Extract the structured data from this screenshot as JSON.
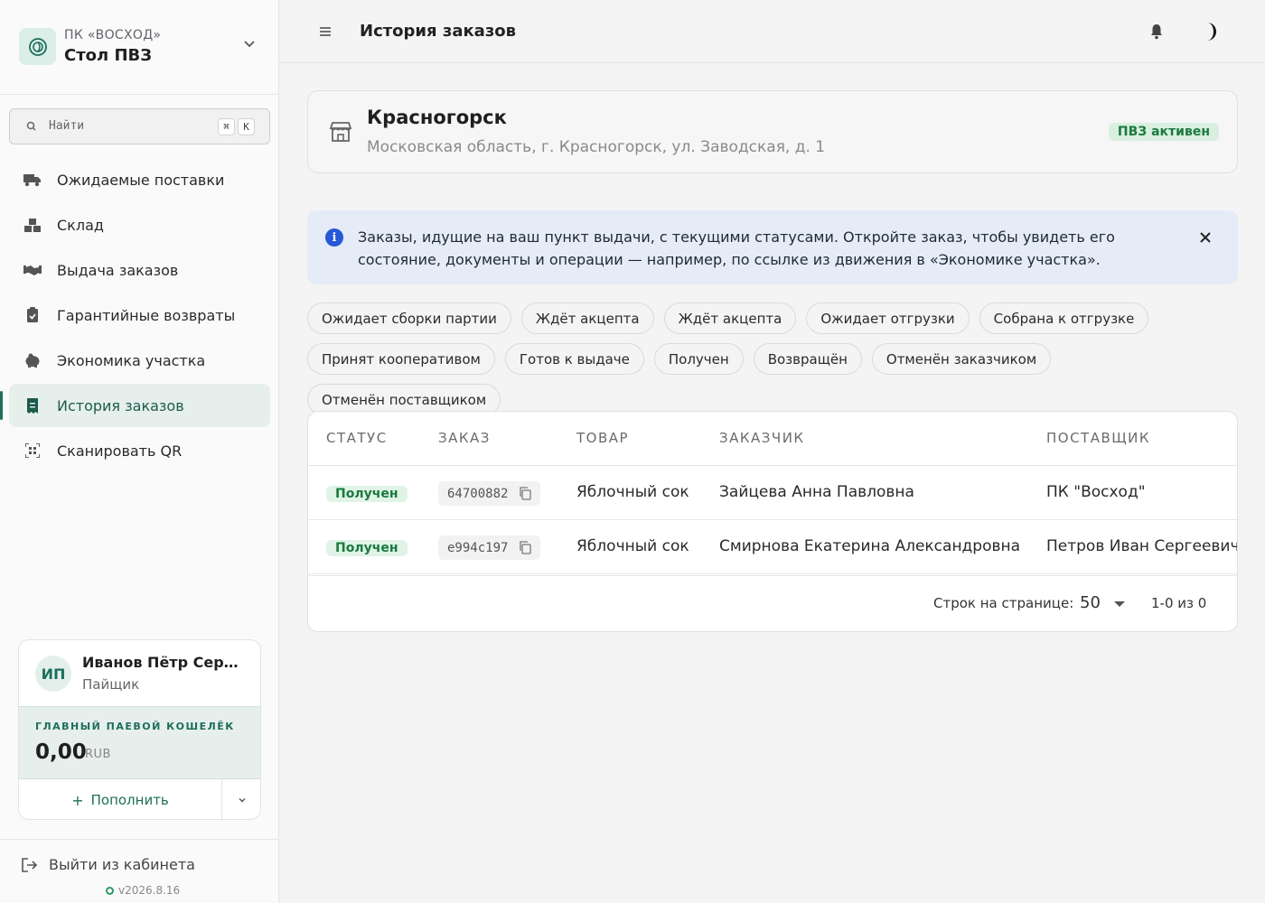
{
  "sidebar": {
    "org_subtitle": "ПК «ВОСХОД»",
    "org_name": "Стол ПВЗ",
    "search_placeholder": "Найти",
    "search_shortcut": [
      "⌘",
      "K"
    ],
    "nav": [
      {
        "label": "Ожидаемые поставки",
        "icon": "truck-icon"
      },
      {
        "label": "Склад",
        "icon": "boxes-icon"
      },
      {
        "label": "Выдача заказов",
        "icon": "handshake-icon"
      },
      {
        "label": "Гарантийные возвраты",
        "icon": "clipboard-check-icon"
      },
      {
        "label": "Экономика участка",
        "icon": "piggy-bank-icon"
      },
      {
        "label": "История заказов",
        "icon": "receipt-icon",
        "active": true
      },
      {
        "label": "Сканировать QR",
        "icon": "qr-scan-icon"
      }
    ],
    "user": {
      "initials": "ИП",
      "name": "Иванов Пётр Сергеевич",
      "role": "Пайщик"
    },
    "wallet": {
      "title": "ГЛАВНЫЙ ПАЕВОЙ КОШЕЛЁК",
      "amount": "0,00",
      "currency": "RUB",
      "topup_label": "Пополнить"
    },
    "logout_label": "Выйти из кабинета",
    "version": "v2026.8.16"
  },
  "header": {
    "title": "История заказов"
  },
  "location": {
    "city": "Красногорск",
    "address": "Московская область, г. Красногорск, ул. Заводская, д. 1",
    "status": "ПВЗ активен"
  },
  "info": {
    "text": "Заказы, идущие на ваш пункт выдачи, с текущими статусами. Откройте заказ, чтобы увидеть его состояние, документы и операции — например, по ссылке из движения в «Экономике участка»."
  },
  "filters": [
    "Ожидает сборки партии",
    "Ждёт акцепта",
    "Ждёт акцепта",
    "Ожидает отгрузки",
    "Собрана к отгрузке",
    "Принят кооперативом",
    "Готов к выдаче",
    "Получен",
    "Возвращён",
    "Отменён заказчиком",
    "Отменён поставщиком"
  ],
  "table": {
    "columns": [
      "СТАТУС",
      "ЗАКАЗ",
      "ТОВАР",
      "ЗАКАЗЧИК",
      "ПОСТАВЩИК"
    ],
    "rows": [
      {
        "status": "Получен",
        "order": "64700882",
        "product": "Яблочный сок",
        "customer": "Зайцева Анна Павловна",
        "supplier": "ПК \"Восход\""
      },
      {
        "status": "Получен",
        "order": "e994c197",
        "product": "Яблочный сок",
        "customer": "Смирнова Екатерина Александровна",
        "supplier": "Петров Иван Сергеевич"
      }
    ],
    "rows_per_page_label": "Строк на странице:",
    "rows_per_page": "50",
    "range": "1-0 из 0"
  },
  "colors": {
    "accent": "#1d6e5a",
    "info_blue": "#2758d6",
    "success_bg": "#e0f3e7",
    "success_text": "#1a7a3f"
  }
}
